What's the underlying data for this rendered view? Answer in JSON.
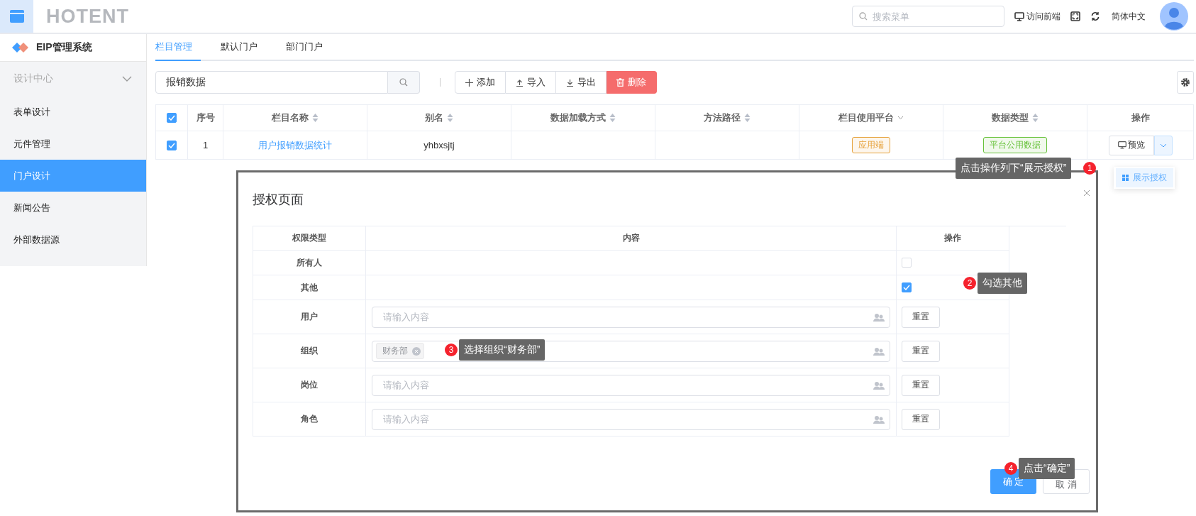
{
  "header": {
    "logo": "HOTENT",
    "search": {
      "placeholder": "搜索菜单"
    },
    "front_link": "访问前端",
    "language": "简体中文"
  },
  "sidebar": {
    "system_title": "EIP管理系统",
    "group": {
      "label": "设计中心",
      "expanded": true
    },
    "items": [
      {
        "label": "表单设计",
        "selected": false
      },
      {
        "label": "元件管理",
        "selected": false
      },
      {
        "label": "门户设计",
        "selected": true
      },
      {
        "label": "新闻公告",
        "selected": false
      },
      {
        "label": "外部数据源",
        "selected": false
      }
    ]
  },
  "tabs": [
    {
      "label": "栏目管理",
      "selected": true
    },
    {
      "label": "默认门户",
      "selected": false
    },
    {
      "label": "部门门户",
      "selected": false
    }
  ],
  "toolbar": {
    "search_value": "报销数据",
    "buttons": [
      {
        "label": "添加",
        "kind": "add"
      },
      {
        "label": "导入",
        "kind": "import"
      },
      {
        "label": "导出",
        "kind": "export"
      },
      {
        "label": "删除",
        "kind": "delete"
      }
    ]
  },
  "table": {
    "all_checked": true,
    "columns": [
      "序号",
      "栏目名称",
      "别名",
      "数据加载方式",
      "方法路径",
      "栏目使用平台",
      "数据类型",
      "操作"
    ],
    "rows": [
      {
        "checked": true,
        "index": "1",
        "name": "用户报销数据统计",
        "alias": "yhbxsjtj",
        "platform": {
          "text": "应用端",
          "color": "#e6a23c"
        },
        "data_type": {
          "text": "平台公用数据",
          "color": "#67c23a"
        },
        "action": "预览"
      }
    ]
  },
  "row_menu": {
    "items": [
      "展示授权"
    ]
  },
  "dialog": {
    "title": "授权页面",
    "columns": [
      "权限类型",
      "内容",
      "操作"
    ],
    "rows": [
      {
        "type": "所有人",
        "kind": "checkbox",
        "checked": false
      },
      {
        "type": "其他",
        "kind": "checkbox",
        "checked": true
      },
      {
        "type": "用户",
        "kind": "picker",
        "placeholder": "请输入内容",
        "reset": "重置"
      },
      {
        "type": "组织",
        "kind": "picker",
        "tags": [
          "财务部"
        ],
        "reset": "重置"
      },
      {
        "type": "岗位",
        "kind": "picker",
        "placeholder": "请输入内容",
        "reset": "重置"
      },
      {
        "type": "角色",
        "kind": "picker",
        "placeholder": "请输入内容",
        "reset": "重置"
      }
    ],
    "confirm": "确 定",
    "cancel": "取 消"
  },
  "callouts": [
    {
      "number": "1",
      "text": "点击操作列下“展示授权”"
    },
    {
      "number": "2",
      "text": "勾选其他"
    },
    {
      "number": "3",
      "text": "选择组织“财务部”"
    },
    {
      "number": "4",
      "text": "点击“确定”"
    }
  ]
}
